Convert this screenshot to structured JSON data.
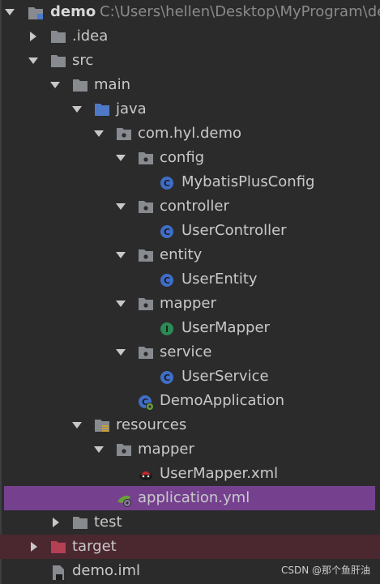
{
  "tree": {
    "root": {
      "label": "demo",
      "path": "C:\\Users\\hellen\\Desktop\\MyProgram\\de"
    },
    "items": [
      {
        "label": ".idea"
      },
      {
        "label": "src"
      },
      {
        "label": "main"
      },
      {
        "label": "java"
      },
      {
        "label": "com.hyl.demo"
      },
      {
        "label": "config"
      },
      {
        "label": "MybatisPlusConfig"
      },
      {
        "label": "controller"
      },
      {
        "label": "UserController"
      },
      {
        "label": "entity"
      },
      {
        "label": "UserEntity"
      },
      {
        "label": "mapper"
      },
      {
        "label": "UserMapper"
      },
      {
        "label": "service"
      },
      {
        "label": "UserService"
      },
      {
        "label": "DemoApplication"
      },
      {
        "label": "resources"
      },
      {
        "label": "mapper"
      },
      {
        "label": "UserMapper.xml"
      },
      {
        "label": "application.yml"
      },
      {
        "label": "test"
      },
      {
        "label": "target"
      },
      {
        "label": "demo.iml"
      }
    ]
  },
  "watermark": "CSDN @那个鱼肝油",
  "colors": {
    "selected_row": "#75418f",
    "excluded_row": "#4b2730",
    "folder": "#878a8e",
    "source_folder": "#4f79c6",
    "class_icon": "#3f6ec7",
    "interface_icon": "#2b8a55",
    "excluded_folder": "#b34053"
  }
}
